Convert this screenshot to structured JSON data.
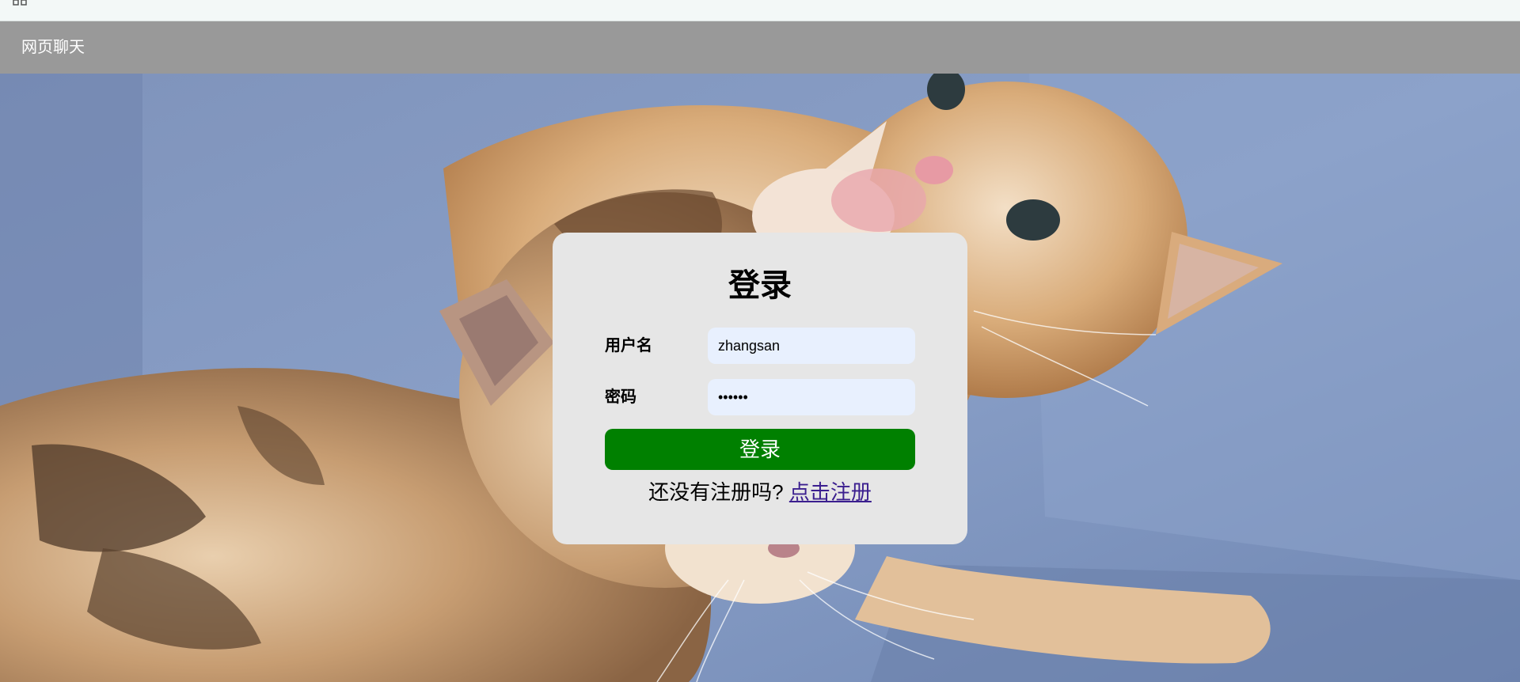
{
  "browser": {
    "apps_icon": "apps-grid-icon"
  },
  "nav": {
    "title": "网页聊天"
  },
  "background": {
    "description_icon": "cat-photo"
  },
  "login": {
    "title": "登录",
    "username_label": "用户名",
    "username_value": "zhangsan",
    "password_label": "密码",
    "password_mask": "••••••",
    "button_label": "登录",
    "register_prompt": "还没有注册吗?",
    "register_link": "点击注册"
  },
  "colors": {
    "nav_bg": "#999999",
    "card_bg": "#e6e6e6",
    "button_bg": "#008000",
    "input_bg": "#e8f0fe",
    "link": "#3b1f8f"
  }
}
